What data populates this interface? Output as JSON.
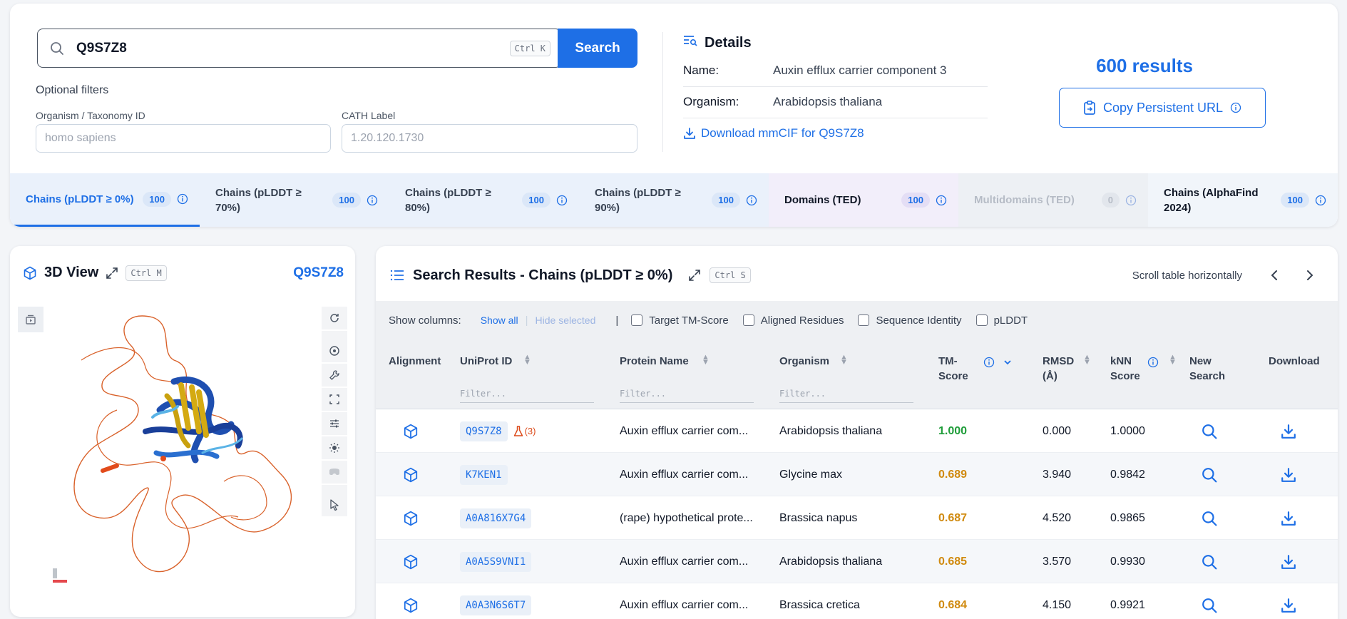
{
  "search": {
    "value": "Q9S7Z8",
    "shortcut": "Ctrl K",
    "button": "Search"
  },
  "filters": {
    "title": "Optional filters",
    "organism_label": "Organism / Taxonomy ID",
    "organism_placeholder": "homo sapiens",
    "cath_label": "CATH Label",
    "cath_placeholder": "1.20.120.1730"
  },
  "details": {
    "title": "Details",
    "name_key": "Name:",
    "name_value": "Auxin efflux carrier component 3",
    "organism_key": "Organism:",
    "organism_value": "Arabidopsis thaliana",
    "download_label": "Download mmCIF for Q9S7Z8"
  },
  "results_count": "600 results",
  "copy_url_label": "Copy Persistent URL",
  "tabs": [
    {
      "label": "Chains (pLDDT ≥ 0%)",
      "count": "100",
      "state": "active"
    },
    {
      "label": "Chains (pLDDT ≥ 70%)",
      "count": "100",
      "state": "normal"
    },
    {
      "label": "Chains (pLDDT ≥ 80%)",
      "count": "100",
      "state": "normal"
    },
    {
      "label": "Chains (pLDDT ≥ 90%)",
      "count": "100",
      "state": "normal"
    },
    {
      "label": "Domains (TED)",
      "count": "100",
      "state": "normal"
    },
    {
      "label": "Multidomains (TED)",
      "count": "0",
      "state": "disabled"
    },
    {
      "label": "Chains (AlphaFind 2024)",
      "count": "100",
      "state": "normal"
    }
  ],
  "viewer": {
    "title": "3D View",
    "shortcut": "Ctrl M",
    "protein_id": "Q9S7Z8"
  },
  "results": {
    "title": "Search Results - Chains (pLDDT ≥ 0%)",
    "shortcut": "Ctrl S",
    "scroll_hint": "Scroll table horizontally",
    "show_columns_label": "Show columns:",
    "show_all": "Show all",
    "hide_selected": "Hide selected",
    "separator": "|",
    "optional_columns": [
      "Target TM-Score",
      "Aligned Residues",
      "Sequence Identity",
      "pLDDT"
    ],
    "filter_placeholder": "Filter...",
    "headers": {
      "alignment": "Alignment",
      "uniprot": "UniProt ID",
      "protein": "Protein Name",
      "organism": "Organism",
      "tm_score": "TM-\nScore",
      "rmsd": "RMSD\n(Å)",
      "knn": "kNN\nScore",
      "new_search": "New\nSearch",
      "download": "Download"
    },
    "rows": [
      {
        "uniprot": "Q9S7Z8",
        "experimental": "(3)",
        "protein": "Auxin efflux carrier com...",
        "organism": "Arabidopsis thaliana",
        "tm": "1.000",
        "tm_color": "#1f9d3a",
        "rmsd": "0.000",
        "knn": "1.0000"
      },
      {
        "uniprot": "K7KEN1",
        "experimental": "",
        "protein": "Auxin efflux carrier com...",
        "organism": "Glycine max",
        "tm": "0.689",
        "tm_color": "#d08a0f",
        "rmsd": "3.940",
        "knn": "0.9842"
      },
      {
        "uniprot": "A0A816X7G4",
        "experimental": "",
        "protein": "(rape) hypothetical prote...",
        "organism": "Brassica napus",
        "tm": "0.687",
        "tm_color": "#d08a0f",
        "rmsd": "4.520",
        "knn": "0.9865"
      },
      {
        "uniprot": "A0A5S9VNI1",
        "experimental": "",
        "protein": "Auxin efflux carrier com...",
        "organism": "Arabidopsis thaliana",
        "tm": "0.685",
        "tm_color": "#d08a0f",
        "rmsd": "3.570",
        "knn": "0.9930"
      },
      {
        "uniprot": "A0A3N6S6T7",
        "experimental": "",
        "protein": "Auxin efflux carrier com...",
        "organism": "Brassica cretica",
        "tm": "0.684",
        "tm_color": "#d08a0f",
        "rmsd": "4.150",
        "knn": "0.9921"
      }
    ]
  },
  "colors": {
    "accent": "#1e6fe6",
    "good": "#1f9d3a",
    "mid": "#d08a0f"
  }
}
